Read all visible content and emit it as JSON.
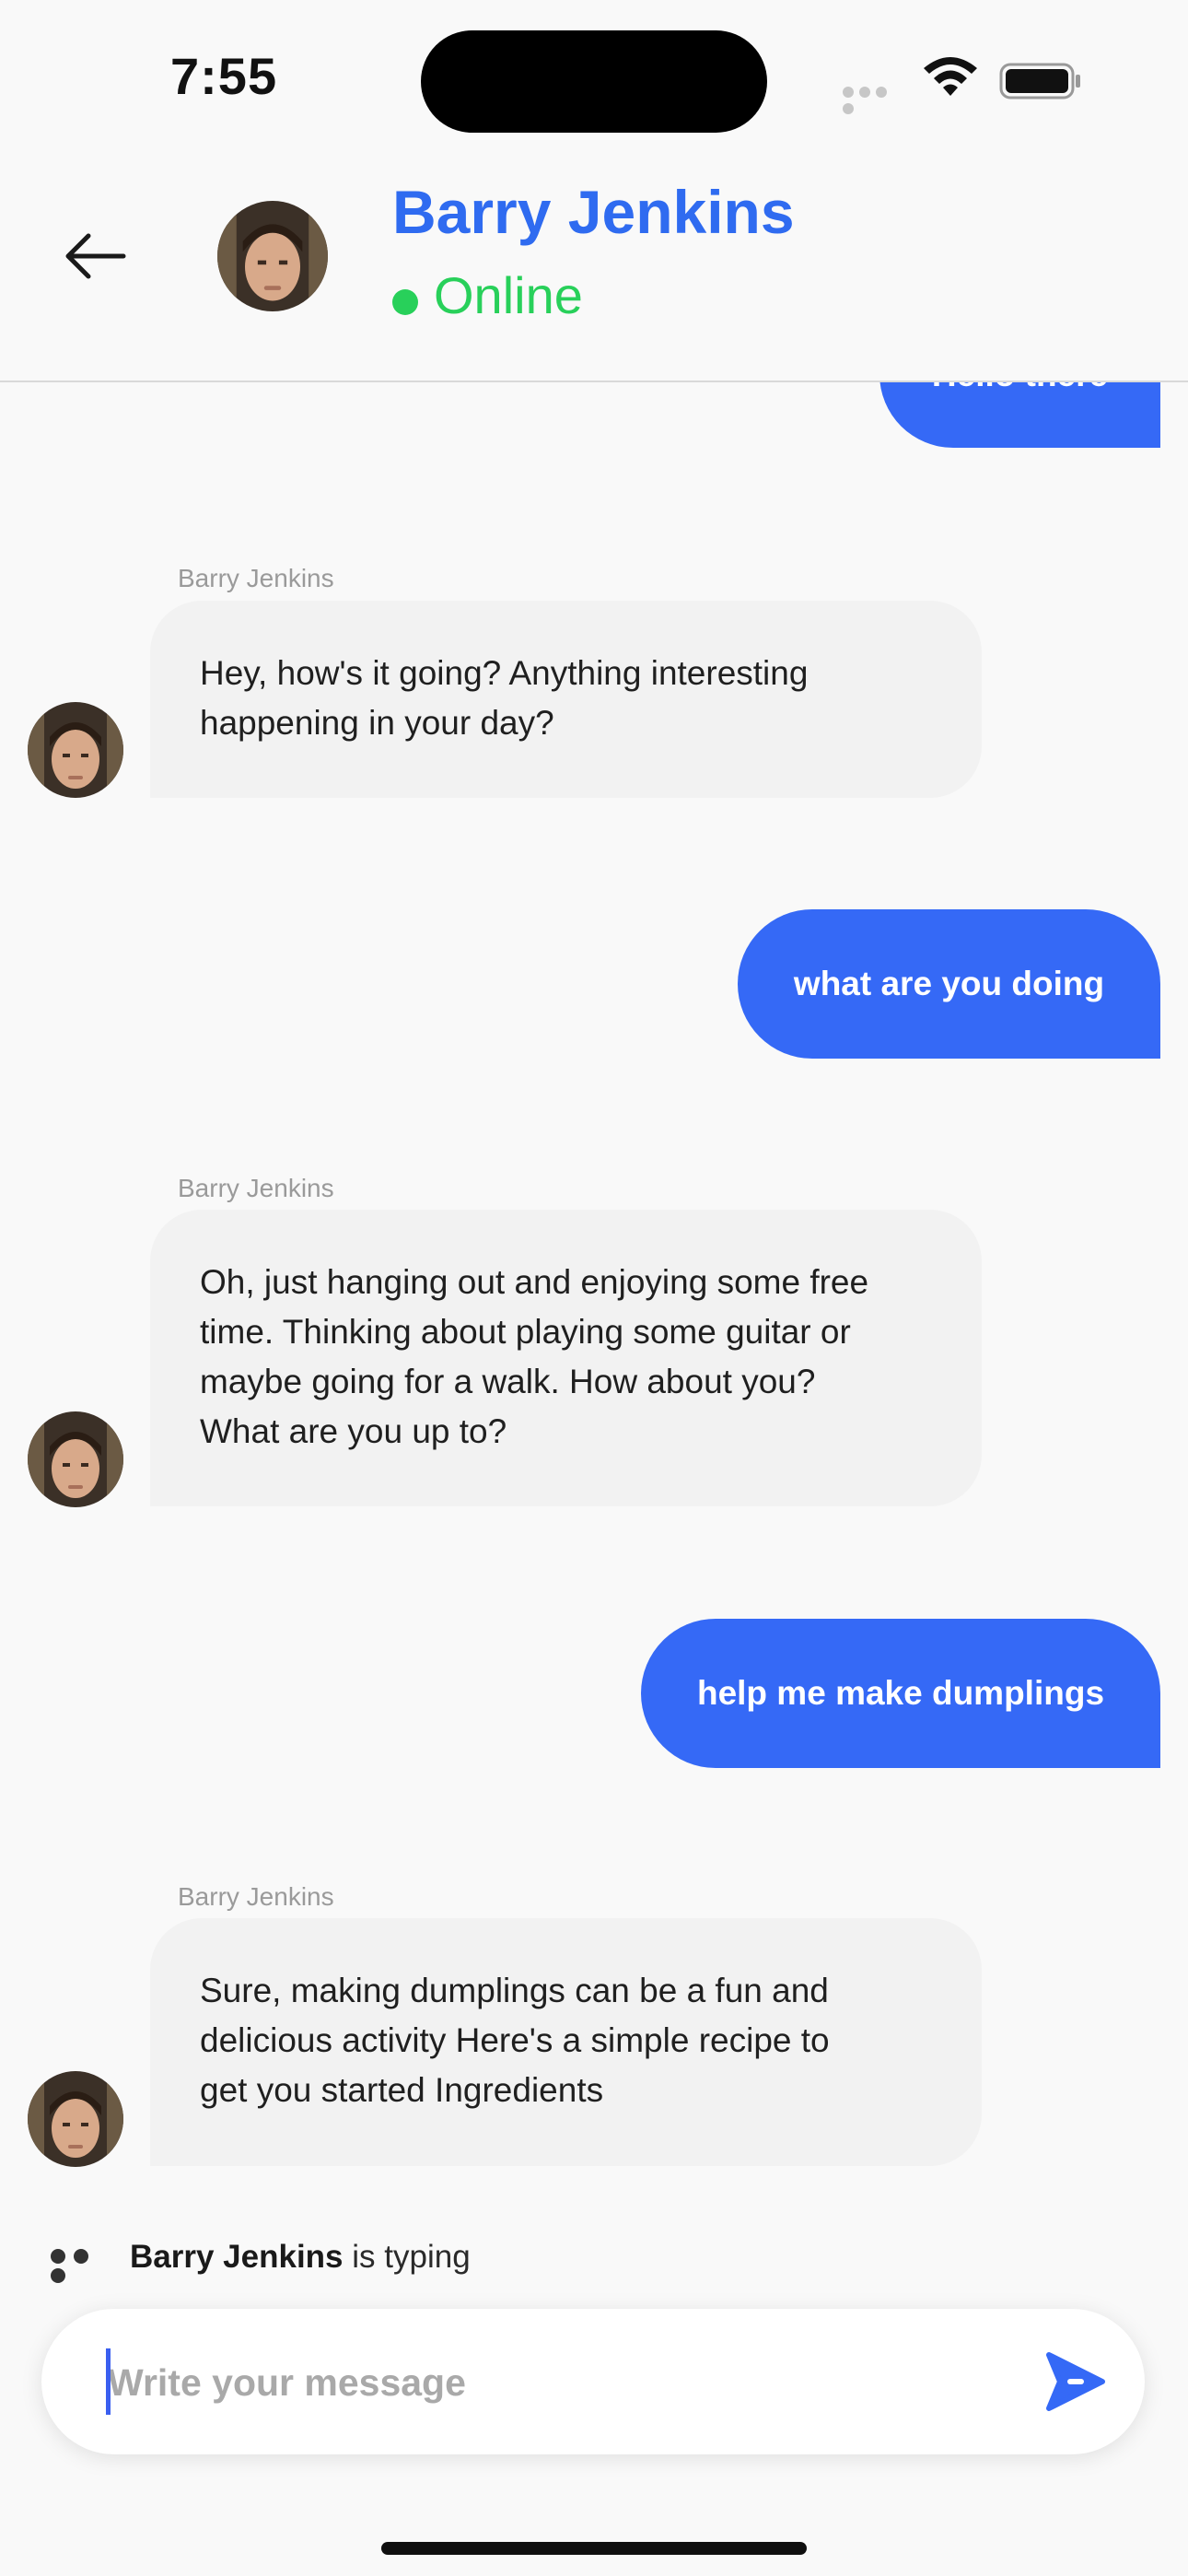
{
  "status_bar": {
    "time": "7:55"
  },
  "header": {
    "contact_name": "Barry Jenkins",
    "status": "Online",
    "status_color": "#28d05a",
    "accent_color": "#2f6bf0"
  },
  "messages": [
    {
      "side": "outgoing",
      "text": "Hello there"
    },
    {
      "side": "incoming",
      "sender": "Barry Jenkins",
      "lines": [
        "Hey, how's it going? Anything interesting",
        "happening in your day?"
      ]
    },
    {
      "side": "outgoing",
      "text": "what are you doing"
    },
    {
      "side": "incoming",
      "sender": "Barry Jenkins",
      "lines": [
        "Oh, just hanging out and enjoying some free",
        "time. Thinking about playing some guitar or",
        "maybe going for a walk. How about you?",
        "What are you up to?"
      ]
    },
    {
      "side": "outgoing",
      "text": "help me make dumplings"
    },
    {
      "side": "incoming",
      "sender": "Barry Jenkins",
      "lines": [
        "Sure, making dumplings can be a fun and",
        "delicious activity Here's a simple recipe to",
        "get you started Ingredients"
      ]
    }
  ],
  "typing": {
    "name": "Barry Jenkins",
    "suffix": "is typing"
  },
  "composer": {
    "placeholder": "Write your message",
    "value": ""
  },
  "colors": {
    "outgoing_bubble": "#3569f6",
    "incoming_bubble": "#f2f2f2",
    "background": "#f9f9f9"
  }
}
